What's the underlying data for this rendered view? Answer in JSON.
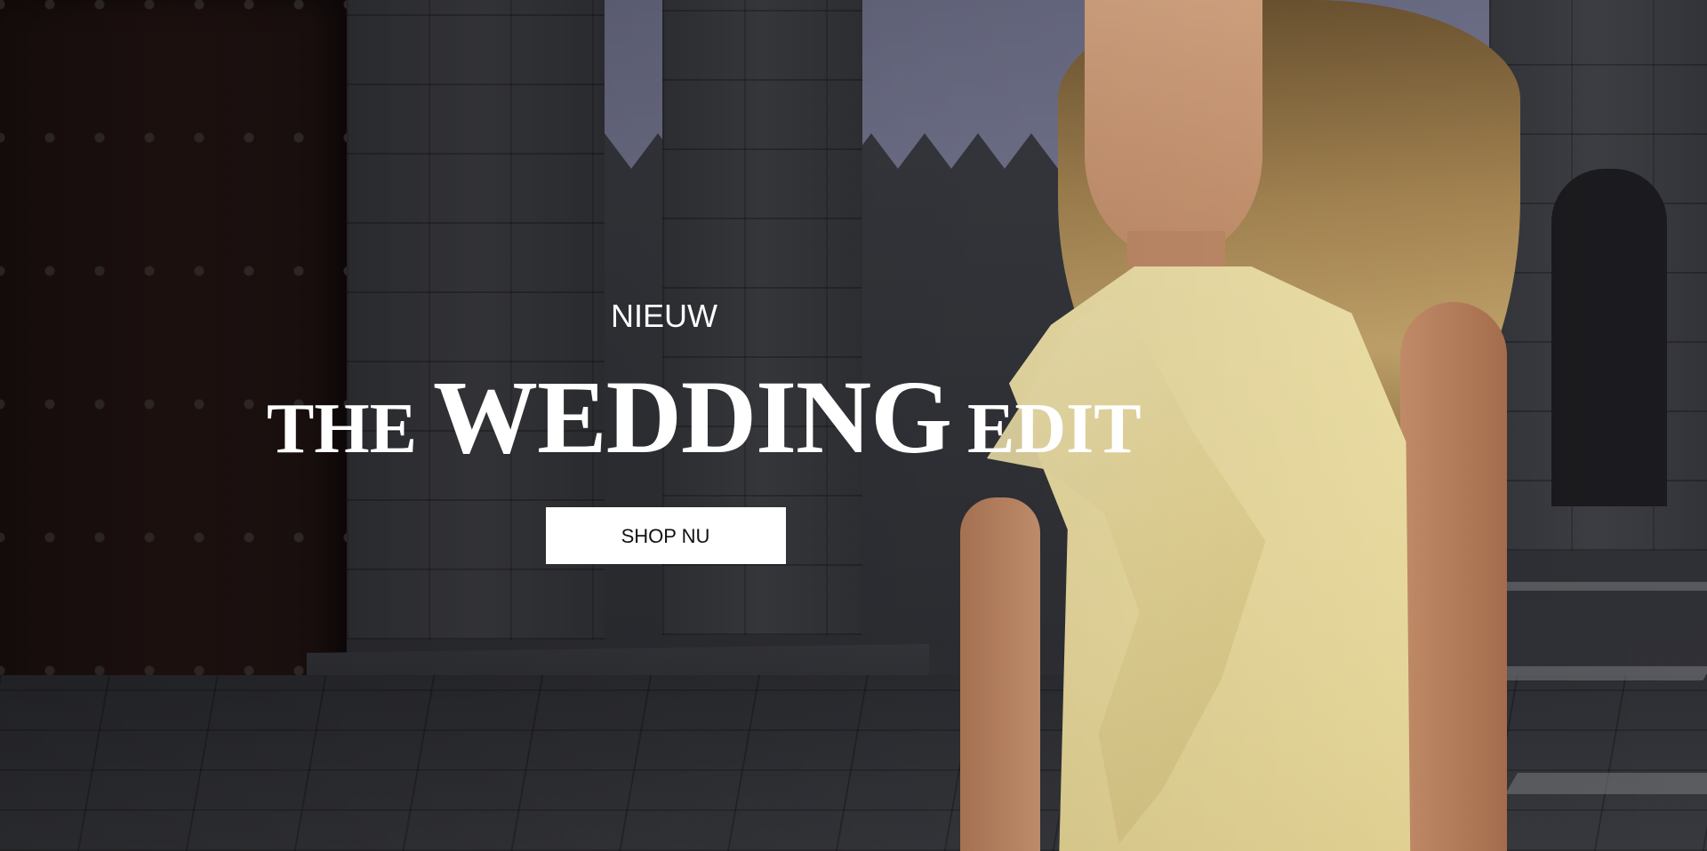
{
  "hero": {
    "kicker": "NIEUW",
    "headline": {
      "part1": "THE",
      "part2": "WEDDING",
      "part3": "EDIT"
    },
    "cta_label": "SHOP NU"
  },
  "colors": {
    "text": "#ffffff",
    "button_bg": "#ffffff",
    "button_text": "#111111",
    "dress": "#f3e5ab"
  }
}
